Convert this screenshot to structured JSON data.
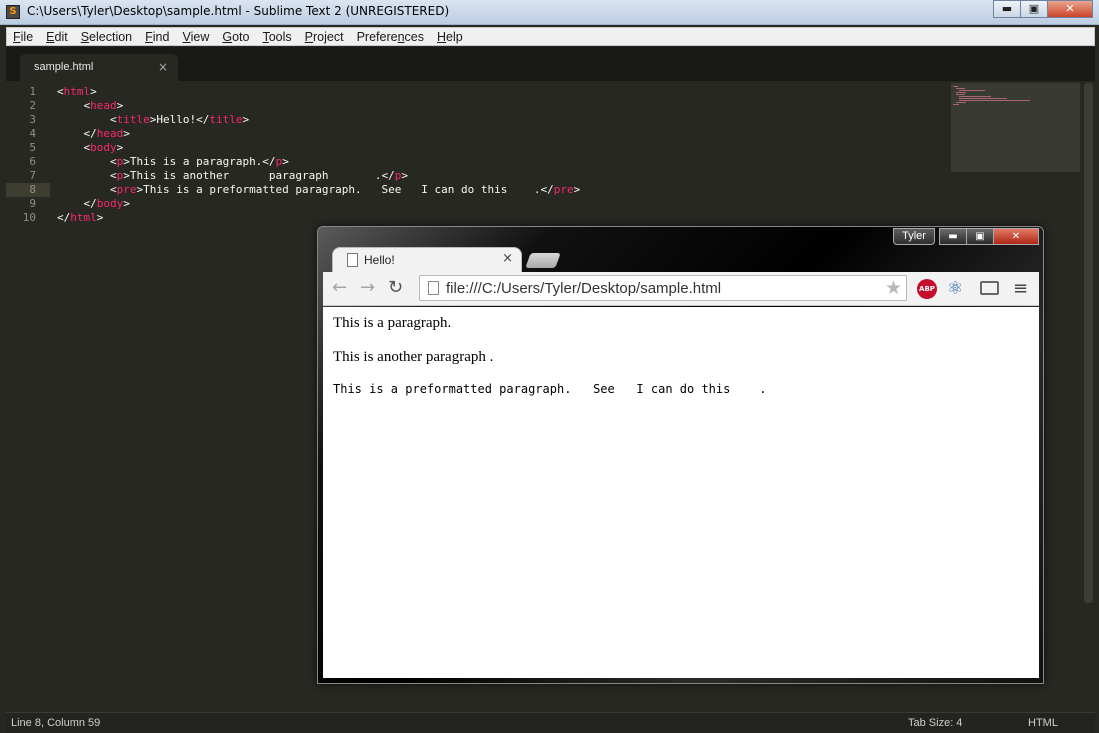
{
  "sublime": {
    "title": "C:\\Users\\Tyler\\Desktop\\sample.html - Sublime Text 2 (UNREGISTERED)",
    "app_icon": "sublime-icon",
    "window_buttons": {
      "minimize": "▬",
      "maximize": "▣",
      "close": "✕"
    },
    "menu": [
      {
        "u": "F",
        "rest": "ile"
      },
      {
        "u": "E",
        "rest": "dit"
      },
      {
        "u": "S",
        "rest": "election"
      },
      {
        "u": "F",
        "rest": "ind"
      },
      {
        "u": "V",
        "rest": "iew"
      },
      {
        "u": "G",
        "rest": "oto"
      },
      {
        "u": "T",
        "rest": "ools"
      },
      {
        "u": "P",
        "rest": "roject"
      },
      {
        "u": "Prefere",
        "rest": "nces",
        "underline_last": true
      },
      {
        "u": "H",
        "rest": "elp"
      }
    ],
    "tab": {
      "label": "sample.html",
      "close": "×"
    },
    "lines": [
      {
        "n": "1",
        "indent": "",
        "parts": [
          [
            "p",
            "<"
          ],
          [
            "t",
            "html"
          ],
          [
            "p",
            ">"
          ]
        ]
      },
      {
        "n": "2",
        "indent": "    ",
        "parts": [
          [
            "p",
            "<"
          ],
          [
            "t",
            "head"
          ],
          [
            "p",
            ">"
          ]
        ]
      },
      {
        "n": "3",
        "indent": "        ",
        "parts": [
          [
            "p",
            "<"
          ],
          [
            "t",
            "title"
          ],
          [
            "p",
            ">Hello!</"
          ],
          [
            "t",
            "title"
          ],
          [
            "p",
            ">"
          ]
        ]
      },
      {
        "n": "4",
        "indent": "    ",
        "parts": [
          [
            "p",
            "</"
          ],
          [
            "t",
            "head"
          ],
          [
            "p",
            ">"
          ]
        ]
      },
      {
        "n": "5",
        "indent": "    ",
        "parts": [
          [
            "p",
            "<"
          ],
          [
            "t",
            "body"
          ],
          [
            "p",
            ">"
          ]
        ]
      },
      {
        "n": "6",
        "indent": "        ",
        "parts": [
          [
            "p",
            "<"
          ],
          [
            "t",
            "p"
          ],
          [
            "p",
            ">This is a paragraph.</"
          ],
          [
            "t",
            "p"
          ],
          [
            "p",
            ">"
          ]
        ]
      },
      {
        "n": "7",
        "indent": "        ",
        "parts": [
          [
            "p",
            "<"
          ],
          [
            "t",
            "p"
          ],
          [
            "p",
            ">This is another      paragraph       .</"
          ],
          [
            "t",
            "p"
          ],
          [
            "p",
            ">"
          ]
        ]
      },
      {
        "n": "8",
        "indent": "        ",
        "parts": [
          [
            "p",
            "<"
          ],
          [
            "t",
            "pre"
          ],
          [
            "p",
            ">This is a preformatted paragraph.   See   I can do this    .</"
          ],
          [
            "t",
            "pre"
          ],
          [
            "p",
            ">"
          ]
        ]
      },
      {
        "n": "9",
        "indent": "    ",
        "parts": [
          [
            "p",
            "</"
          ],
          [
            "t",
            "body"
          ],
          [
            "p",
            ">"
          ]
        ]
      },
      {
        "n": "10",
        "indent": "",
        "parts": [
          [
            "p",
            "</"
          ],
          [
            "t",
            "html"
          ],
          [
            "p",
            ">"
          ]
        ]
      }
    ],
    "status": {
      "position": "Line 8, Column 59",
      "tab_size": "Tab Size: 4",
      "syntax": "HTML"
    },
    "colors": {
      "background": "#272822",
      "tag": "#f92672",
      "text": "#f8f8f2"
    }
  },
  "chrome": {
    "user": "Tyler",
    "window_buttons": {
      "minimize": "▬",
      "maximize": "▣",
      "close": "✕"
    },
    "tab": {
      "label": "Hello!",
      "close": "×"
    },
    "nav": {
      "back": "←",
      "forward": "→",
      "reload": "↻"
    },
    "url": "file:///C:/Users/Tyler/Desktop/sample.html",
    "star": "★",
    "abp_label": "ABP",
    "ext_icon": "⚛",
    "menu_icon": "≡",
    "content": {
      "p1": "This is a paragraph.",
      "p2": "This is another paragraph .",
      "pre": "This is a preformatted paragraph.   See   I can do this    ."
    }
  }
}
